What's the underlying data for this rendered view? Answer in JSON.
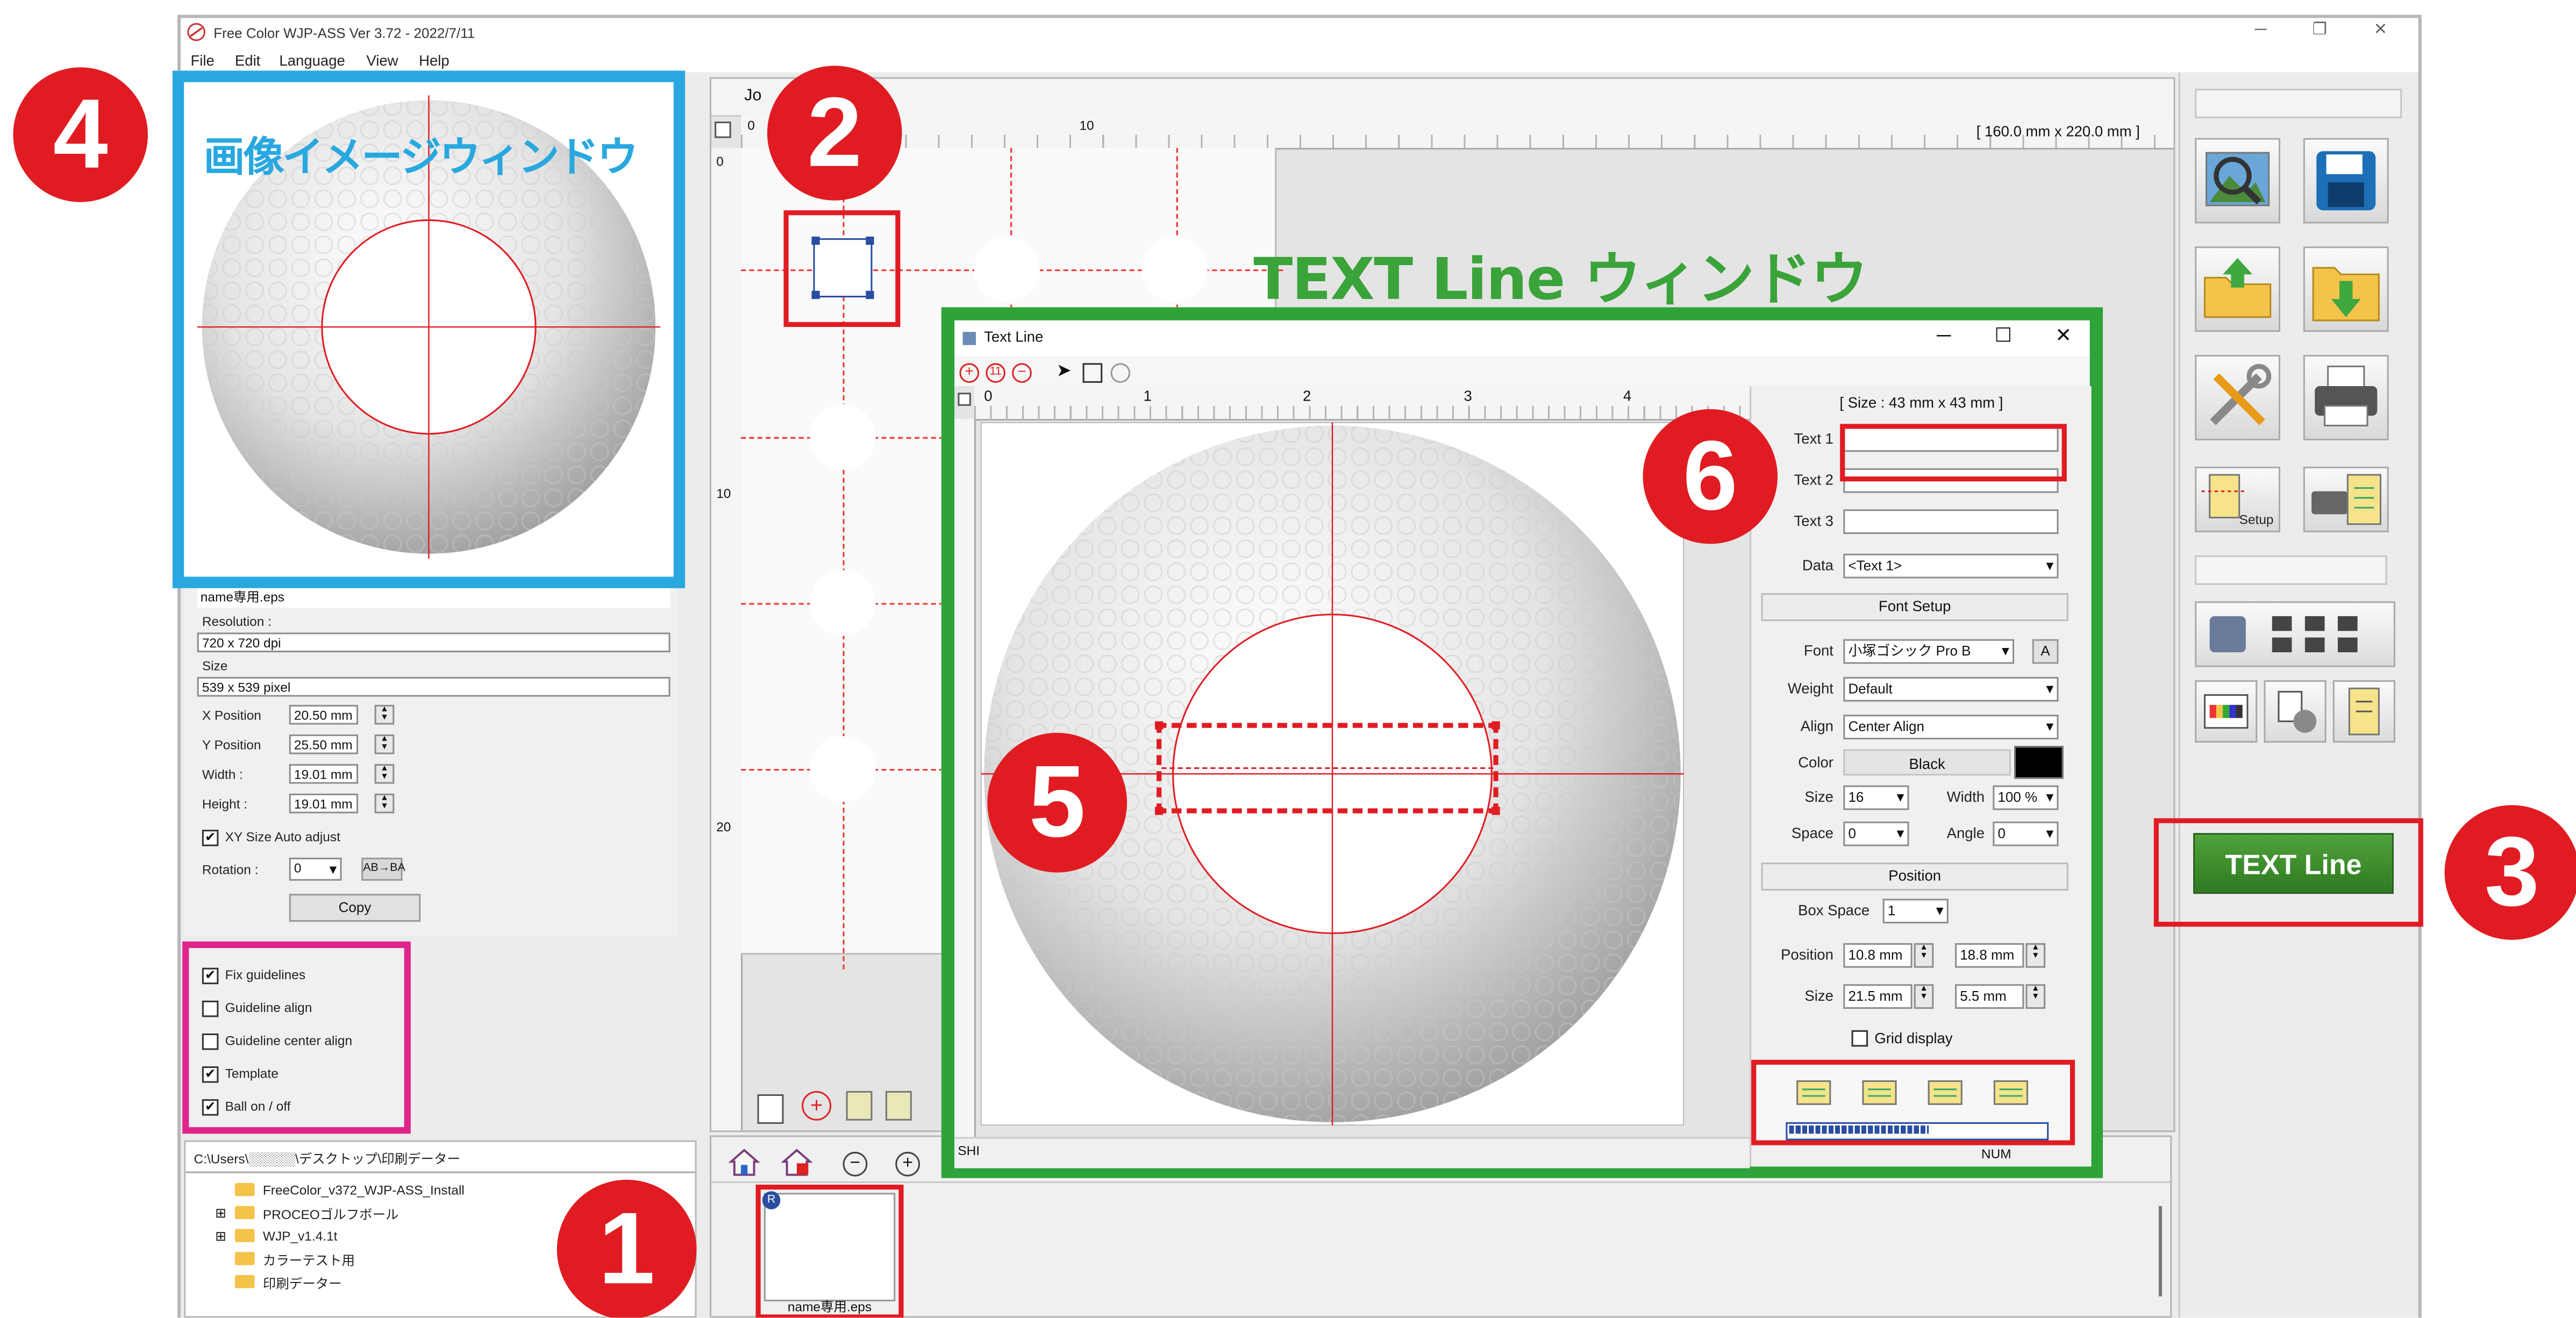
{
  "app": {
    "title": "Free Color WJP-ASS Ver 3.72 - 2022/7/11",
    "window_controls": [
      "─",
      "❐",
      "✕"
    ]
  },
  "menu": [
    "File",
    "Edit",
    "Language",
    "View",
    "Help"
  ],
  "image_panel": {
    "overlay_label": "画像イメージウィンドウ",
    "filename": "name専用.eps",
    "resolution_label": "Resolution :",
    "resolution_value": "720 x 720 dpi",
    "size_label": "Size",
    "size_value": "539 x 539 pixel",
    "x_label": "X Position",
    "x_value": "20.50 mm",
    "y_label": "Y Position",
    "y_value": "25.50 mm",
    "w_label": "Width :",
    "w_value": "19.01 mm",
    "h_label": "Height :",
    "h_value": "19.01 mm",
    "autoadjust_label": "XY Size Auto adjust",
    "rotation_label": "Rotation :",
    "rotation_value": "0",
    "flip_label": "AB→BA",
    "copy_label": "Copy"
  },
  "guideline_options": [
    {
      "label": "Fix guidelines",
      "checked": true,
      "mark": "✔"
    },
    {
      "label": "Guideline align",
      "checked": false,
      "mark": ""
    },
    {
      "label": "Guideline center align",
      "checked": false,
      "mark": ""
    },
    {
      "label": "Template",
      "checked": true,
      "mark": "✔"
    },
    {
      "label": "Ball on / off",
      "checked": true,
      "mark": "✔"
    }
  ],
  "file_tree": {
    "path": "C:\\Users\\░░░░░\\デスクトップ\\印刷データー",
    "items": [
      {
        "label": "FreeColor_v372_WJP-ASS_Install",
        "expander": ""
      },
      {
        "label": "PROCEOゴルフボール",
        "expander": "⊞"
      },
      {
        "label": "WJP_v1.4.1t",
        "expander": "⊞"
      },
      {
        "label": "カラーテスト用",
        "expander": ""
      },
      {
        "label": "印刷データー",
        "expander": ""
      }
    ]
  },
  "canvas": {
    "tab_label": "Jo",
    "size_readout": "[ 160.0 mm x 220.0 mm ]",
    "hruler": [
      "0",
      "10"
    ],
    "vruler": [
      "0",
      "10",
      "20"
    ]
  },
  "thumbnail": {
    "badge": "R",
    "label": "name専用.eps"
  },
  "text_line_window": {
    "overlay_label": "TEXT Line ウィンドウ",
    "title": "Text Line",
    "size_readout": "[ Size : 43 mm x 43 mm ]",
    "ruler": [
      "0",
      "1",
      "2",
      "3",
      "4"
    ],
    "text1_label": "Text 1",
    "text1_value": "",
    "text2_label": "Text 2",
    "text2_value": "",
    "text3_label": "Text 3",
    "text3_value": "",
    "data_label": "Data",
    "data_value": "<Text 1>",
    "font_setup_label": "Font Setup",
    "font_label": "Font",
    "font_value": "小塚ゴシック Pro B",
    "font_btn": "A",
    "weight_label": "Weight",
    "weight_value": "Default",
    "align_label": "Align",
    "align_value": "Center Align",
    "color_label": "Color",
    "color_value": "Black",
    "size_label": "Size",
    "size_value": "16",
    "width_label": "Width",
    "width_value": "100 %",
    "space_label": "Space",
    "space_value": "0",
    "angle_label": "Angle",
    "angle_value": "0",
    "position_section_label": "Position",
    "boxspace_label": "Box Space",
    "boxspace_value": "1",
    "pos_label": "Position",
    "pos_x": "10.8 mm",
    "pos_y": "18.8 mm",
    "sz_label": "Size",
    "sz_w": "21.5 mm",
    "sz_h": "5.5 mm",
    "grid_label": "Grid display",
    "status_left": "SHI",
    "status_right": "NUM"
  },
  "text_line_button": "TEXT Line",
  "callouts": [
    "1",
    "2",
    "3",
    "4",
    "5",
    "6"
  ],
  "colors": {
    "callout_red": "#e01c22",
    "image_window_blue": "#29a8e0",
    "text_line_green": "#2ea33a",
    "options_magenta": "#e0248c",
    "text_line_button": "#3b8f2a"
  }
}
